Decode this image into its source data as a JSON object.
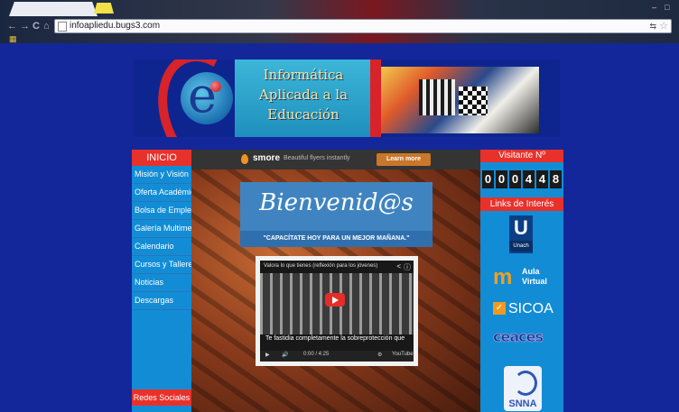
{
  "browser": {
    "url": "infoapliedu.bugs3.com",
    "window_min": "–",
    "window_max": "□",
    "bookmarks_icon": "apps-icon",
    "nav": {
      "back": "←",
      "forward": "→",
      "reload": "C",
      "home": "⌂"
    },
    "translate": "⇆",
    "star": "☆"
  },
  "banner": {
    "title_line1": "Informática",
    "title_line2": "Aplicada a la",
    "title_line3": "Educación"
  },
  "left_sidebar": {
    "header": "INICIO",
    "items": [
      {
        "label": "Misión y Visión"
      },
      {
        "label": "Oferta Académica"
      },
      {
        "label": "Bolsa de Empleo"
      },
      {
        "label": "Galería Multimedia"
      },
      {
        "label": "Calendario"
      },
      {
        "label": "Cursos y Talleres"
      },
      {
        "label": "Noticias"
      },
      {
        "label": "Descargas"
      }
    ],
    "footer": "Redes Sociales"
  },
  "smore_bar": {
    "brand": "smore",
    "tagline": "Beautiful flyers instantly",
    "cta": "Learn more"
  },
  "welcome": {
    "heading": "Bienvenid@s",
    "motto": "\"CAPACÍTATE HOY PARA UN MEJOR MAÑANA.\""
  },
  "video": {
    "title": "Valora lo que tienes (reflexión para los jóvenes)",
    "caption": "Te fastidia completamente la sobreprotección que",
    "time": "0:00 / 4:25",
    "brand": "YouTube"
  },
  "right_sidebar": {
    "visitor_header": "Visitante Nº",
    "visitor_count": [
      "0",
      "0",
      "0",
      "4",
      "4",
      "8"
    ],
    "links_header": "Links de Interés",
    "links": {
      "unach": "Unach",
      "aula_m": "m",
      "aula_label_1": "Aula",
      "aula_label_2": "Virtual",
      "sicoa": "SICOA",
      "ceaces": "ceaces",
      "snna": "SNNA"
    }
  }
}
